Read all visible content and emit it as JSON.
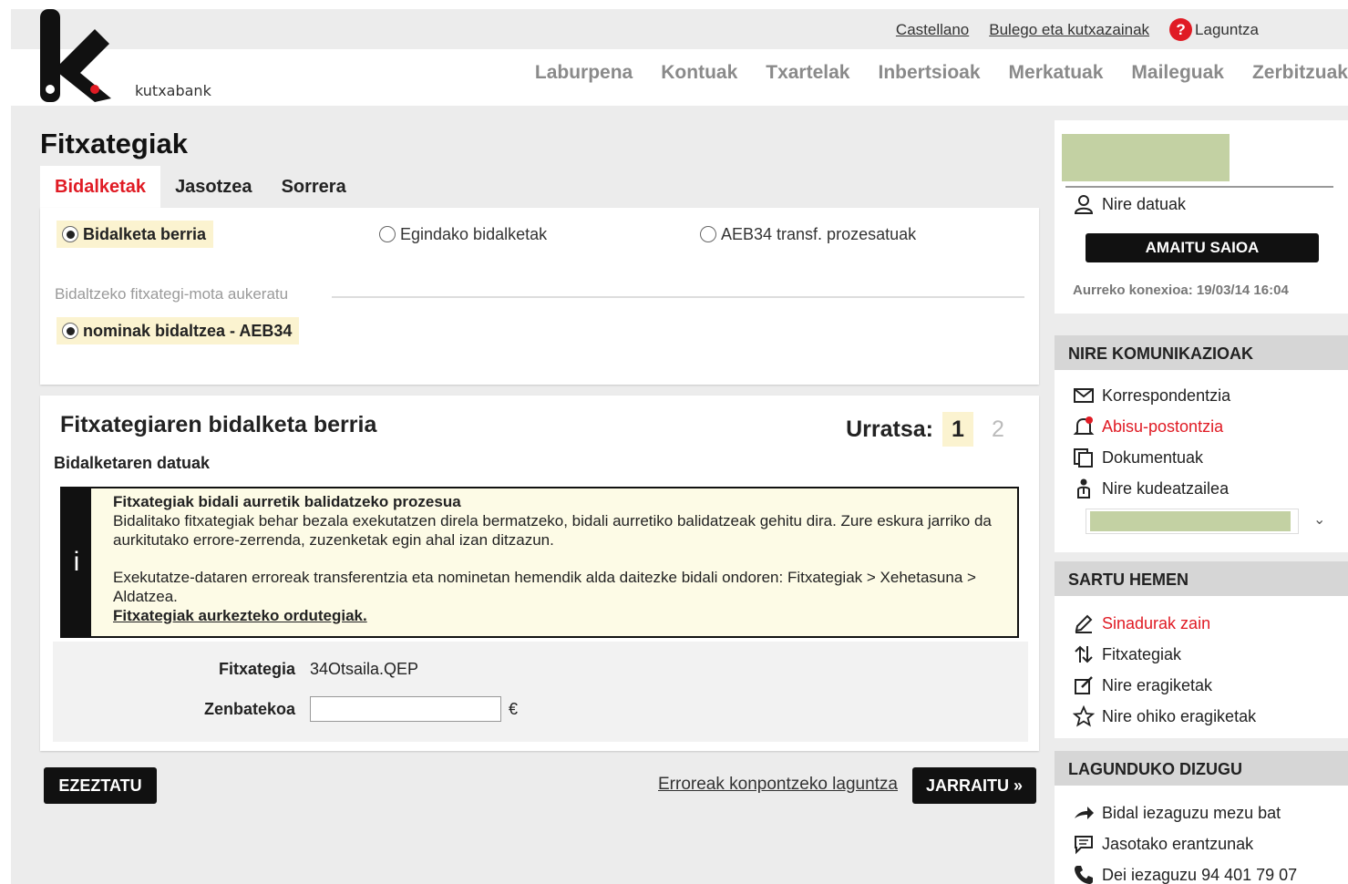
{
  "header": {
    "logo_text": "kutxabank",
    "top_links": {
      "language": "Castellano",
      "offices": "Bulego eta kutxazainak",
      "help": "Laguntza"
    },
    "nav": [
      "Laburpena",
      "Kontuak",
      "Txartelak",
      "Inbertsioak",
      "Merkatuak",
      "Maileguak",
      "Zerbitzuak"
    ]
  },
  "main": {
    "title": "Fitxategiak",
    "tabs": [
      "Bidalketak",
      "Jasotzea",
      "Sorrera"
    ],
    "active_tab": "Bidalketak",
    "radios": [
      {
        "label": "Bidalketa berria",
        "selected": true
      },
      {
        "label": "Egindako bidalketak",
        "selected": false
      },
      {
        "label": "AEB34 transf. prozesatuak",
        "selected": false
      }
    ],
    "section_label": "Bidaltzeko fitxategi-mota aukeratu",
    "file_type_radio": {
      "label": "nominak bidaltzea - AEB34",
      "selected": true
    },
    "form": {
      "title": "Fitxategiaren bidalketa berria",
      "step_label": "Urratsa:",
      "steps": [
        "1",
        "2"
      ],
      "active_step": "1",
      "subsection": "Bidalketaren datuak",
      "info": {
        "icon": "i",
        "title": "Fitxategiak bidali aurretik balidatzeko prozesua",
        "para1": "Bidalitako fitxategiak behar bezala exekutatzen direla bermatzeko, bidali aurretiko balidatzeak gehitu dira. Zure eskura jarriko da aurkitutako errore-zerrenda, zuzenketak egin ahal izan ditzazun.",
        "para2": "Exekutatze-dataren erroreak transferentzia eta nominetan hemendik alda daitezke bidali ondoren: Fitxategiak > Xehetasuna > Aldatzea.",
        "link": "Fitxategiak aurkezteko ordutegiak."
      },
      "file_label": "Fitxategia",
      "file_value": "34Otsaila.QEP",
      "amount_label": "Zenbatekoa",
      "amount_value": "",
      "currency": "€"
    },
    "buttons": {
      "cancel": "EZEZTATU",
      "help": "Erroreak konpontzeko laguntza",
      "continue": "JARRAITU »"
    }
  },
  "sidebar": {
    "my_data": "Nire datuak",
    "logout": "AMAITU SAIOA",
    "last_connection": "Aurreko konexioa: 19/03/14 16:04",
    "communications": {
      "title": "NIRE KOMUNIKAZIOAK",
      "items": [
        {
          "label": "Korrespondentzia",
          "icon": "envelope-icon",
          "highlight": false
        },
        {
          "label": "Abisu-postontzia",
          "icon": "bell-icon",
          "highlight": true
        },
        {
          "label": "Dokumentuak",
          "icon": "documents-icon",
          "highlight": false
        },
        {
          "label": "Nire kudeatzailea",
          "icon": "manager-icon",
          "highlight": false
        }
      ]
    },
    "enter_here": {
      "title": "SARTU HEMEN",
      "items": [
        {
          "label": "Sinadurak zain",
          "icon": "pen-icon",
          "highlight": true
        },
        {
          "label": "Fitxategiak",
          "icon": "transfer-arrows-icon",
          "highlight": false
        },
        {
          "label": "Nire eragiketak",
          "icon": "edit-icon",
          "highlight": false
        },
        {
          "label": "Nire ohiko eragiketak",
          "icon": "star-icon",
          "highlight": false
        }
      ]
    },
    "help_section": {
      "title": "LAGUNDUKO DIZUGU",
      "items": [
        {
          "label": "Bidal iezaguzu mezu bat",
          "icon": "arrow-icon"
        },
        {
          "label": "Jasotako erantzunak",
          "icon": "chat-icon"
        },
        {
          "label": "Dei iezaguzu 94 401 79 07",
          "icon": "phone-icon"
        }
      ]
    }
  },
  "colors": {
    "accent": "#e01b24",
    "dark": "#111111",
    "highlight_bg": "#fbf3d0",
    "placeholder_green": "#c3d1a3"
  }
}
